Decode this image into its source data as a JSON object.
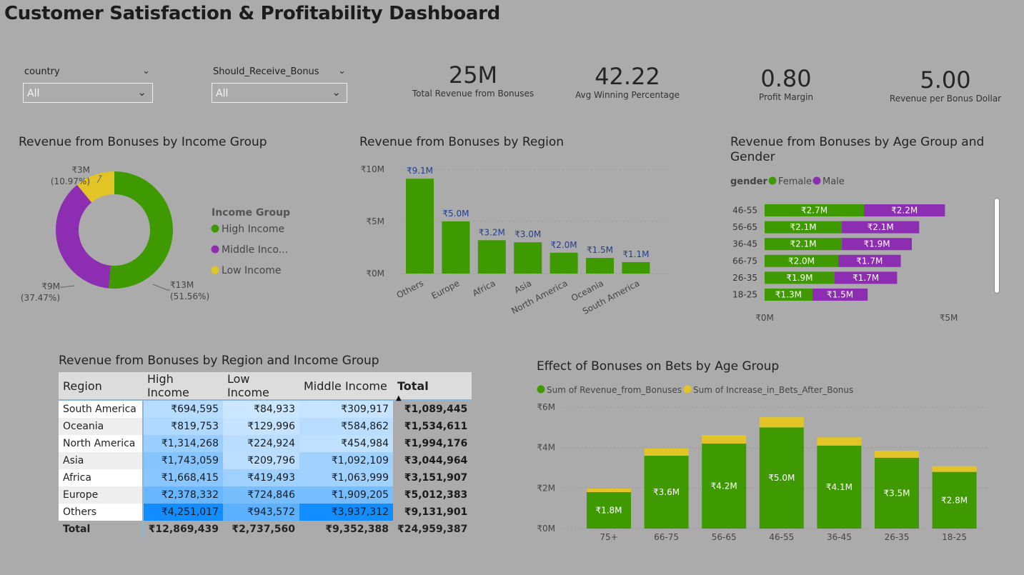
{
  "title": "Customer Satisfaction & Profitability Dashboard",
  "slicers": [
    {
      "label": "country",
      "value": "All"
    },
    {
      "label": "Should_Receive_Bonus",
      "value": "All"
    }
  ],
  "kpis": [
    {
      "value": "25M",
      "label": "Total Revenue from Bonuses"
    },
    {
      "value": "42.22",
      "label": "Avg Winning Percentage"
    },
    {
      "value": "0.80",
      "label": "Profit Margin"
    },
    {
      "value": "5.00",
      "label": "Revenue per Bonus Dollar"
    }
  ],
  "colors": {
    "green": "#3f9a02",
    "purple": "#8d2db2",
    "yellow": "#e3c427",
    "bar_label": "#233e8c",
    "matrix_dark": "#118dff"
  },
  "donut": {
    "title": "Revenue from Bonuses by Income Group",
    "legend_title": "Income Group",
    "slices": [
      {
        "name": "High Income",
        "legend": "High Income",
        "label": "₹13M",
        "pct_label": "(51.56%)",
        "pct": 51.56,
        "color": "#3f9a02"
      },
      {
        "name": "Middle Income",
        "legend": "Middle Inco...",
        "label": "₹9M",
        "pct_label": "(37.47%)",
        "pct": 37.47,
        "color": "#8d2db2"
      },
      {
        "name": "Low Income",
        "legend": "Low Income",
        "label": "₹3M",
        "pct_label": "(10.97%)",
        "pct": 10.97,
        "color": "#e3c427"
      }
    ]
  },
  "region_chart": {
    "title": "Revenue from Bonuses by Region",
    "y_ticks": [
      "₹0M",
      "₹5M",
      "₹10M"
    ],
    "bars": [
      {
        "cat": "Others",
        "label": "₹9.1M"
      },
      {
        "cat": "Europe",
        "label": "₹5.0M"
      },
      {
        "cat": "Africa",
        "label": "₹3.2M"
      },
      {
        "cat": "Asia",
        "label": "₹3.0M"
      },
      {
        "cat": "North America",
        "label": "₹2.0M"
      },
      {
        "cat": "Oceania",
        "label": "₹1.5M"
      },
      {
        "cat": "South America",
        "label": "₹1.1M"
      }
    ]
  },
  "age_gender_chart": {
    "title_line1": "Revenue from Bonuses by Age Group and",
    "title_line2": "Gender",
    "legend_title": "gender",
    "legend": [
      "Female",
      "Male"
    ],
    "x_ticks": [
      "₹0M",
      "₹5M"
    ],
    "rows": [
      {
        "cat": "46-55",
        "f_label": "₹2.7M",
        "m_label": "₹2.2M"
      },
      {
        "cat": "56-65",
        "f_label": "₹2.1M",
        "m_label": "₹2.1M"
      },
      {
        "cat": "36-45",
        "f_label": "₹2.1M",
        "m_label": "₹1.9M"
      },
      {
        "cat": "66-75",
        "f_label": "₹2.0M",
        "m_label": "₹1.7M"
      },
      {
        "cat": "26-35",
        "f_label": "₹1.9M",
        "m_label": "₹1.7M"
      },
      {
        "cat": "18-25",
        "f_label": "₹1.3M",
        "m_label": "₹1.5M"
      }
    ]
  },
  "matrix": {
    "title": "Revenue from Bonuses by Region and Income Group",
    "headers": [
      "Region",
      "High Income",
      "Low Income",
      "Middle Income",
      "Total"
    ],
    "rows": [
      {
        "region": "South America",
        "high": "₹694,595",
        "low": "₹84,933",
        "mid": "₹309,917",
        "total": "₹1,089,445"
      },
      {
        "region": "Oceania",
        "high": "₹819,753",
        "low": "₹129,996",
        "mid": "₹584,862",
        "total": "₹1,534,611"
      },
      {
        "region": "North America",
        "high": "₹1,314,268",
        "low": "₹224,924",
        "mid": "₹454,984",
        "total": "₹1,994,176"
      },
      {
        "region": "Asia",
        "high": "₹1,743,059",
        "low": "₹209,796",
        "mid": "₹1,092,109",
        "total": "₹3,044,964"
      },
      {
        "region": "Africa",
        "high": "₹1,668,415",
        "low": "₹419,493",
        "mid": "₹1,063,999",
        "total": "₹3,151,907"
      },
      {
        "region": "Europe",
        "high": "₹2,378,332",
        "low": "₹724,846",
        "mid": "₹1,909,205",
        "total": "₹5,012,383"
      },
      {
        "region": "Others",
        "high": "₹4,251,017",
        "low": "₹943,572",
        "mid": "₹3,937,312",
        "total": "₹9,131,901"
      }
    ],
    "total_row": {
      "region": "Total",
      "high": "₹12,869,439",
      "low": "₹2,737,560",
      "mid": "₹9,352,388",
      "total": "₹24,959,387"
    }
  },
  "bets_chart": {
    "title": "Effect of Bonuses on Bets by Age Group",
    "legend": [
      "Sum of Revenue_from_Bonuses",
      "Sum of Increase_in_Bets_After_Bonus"
    ],
    "y_ticks": [
      "₹0M",
      "₹2M",
      "₹4M",
      "₹6M"
    ],
    "bars": [
      {
        "cat": "75+",
        "label": "₹1.8M"
      },
      {
        "cat": "66-75",
        "label": "₹3.6M"
      },
      {
        "cat": "56-65",
        "label": "₹4.2M"
      },
      {
        "cat": "46-55",
        "label": "₹5.0M"
      },
      {
        "cat": "36-45",
        "label": "₹4.1M"
      },
      {
        "cat": "26-35",
        "label": "₹3.5M"
      },
      {
        "cat": "18-25",
        "label": "₹2.8M"
      }
    ]
  },
  "chart_data": [
    {
      "type": "pie",
      "title": "Revenue from Bonuses by Income Group",
      "categories": [
        "High Income",
        "Middle Income",
        "Low Income"
      ],
      "values": [
        12.87,
        9.35,
        2.74
      ],
      "percentages": [
        51.56,
        37.47,
        10.97
      ],
      "legend": "right"
    },
    {
      "type": "bar",
      "title": "Revenue from Bonuses by Region",
      "categories": [
        "Others",
        "Europe",
        "Africa",
        "Asia",
        "North America",
        "Oceania",
        "South America"
      ],
      "values": [
        9.1,
        5.0,
        3.2,
        3.0,
        2.0,
        1.5,
        1.1
      ],
      "ylim": [
        0,
        10
      ]
    },
    {
      "type": "bar",
      "orientation": "horizontal",
      "stacked": true,
      "title": "Revenue from Bonuses by Age Group and Gender",
      "categories": [
        "46-55",
        "56-65",
        "36-45",
        "66-75",
        "26-35",
        "18-25"
      ],
      "series": [
        {
          "name": "Female",
          "values": [
            2.7,
            2.1,
            2.1,
            2.0,
            1.9,
            1.3
          ]
        },
        {
          "name": "Male",
          "values": [
            2.2,
            2.1,
            1.9,
            1.7,
            1.7,
            1.5
          ]
        }
      ],
      "xlim": [
        0,
        5
      ],
      "legend": "top-left"
    },
    {
      "type": "table",
      "title": "Revenue from Bonuses by Region and Income Group",
      "columns": [
        "Region",
        "High Income",
        "Low Income",
        "Middle Income",
        "Total"
      ]
    },
    {
      "type": "bar",
      "stacked": true,
      "title": "Effect of Bonuses on Bets by Age Group",
      "categories": [
        "75+",
        "66-75",
        "56-65",
        "46-55",
        "36-45",
        "26-35",
        "18-25"
      ],
      "series": [
        {
          "name": "Sum of Revenue_from_Bonuses",
          "values": [
            1.8,
            3.6,
            4.2,
            5.0,
            4.1,
            3.5,
            2.8
          ]
        },
        {
          "name": "Sum of Increase_in_Bets_After_Bonus",
          "values": [
            0.18,
            0.36,
            0.42,
            0.5,
            0.41,
            0.35,
            0.28
          ]
        }
      ],
      "ylim": [
        0,
        6
      ],
      "legend": "top-left"
    }
  ]
}
